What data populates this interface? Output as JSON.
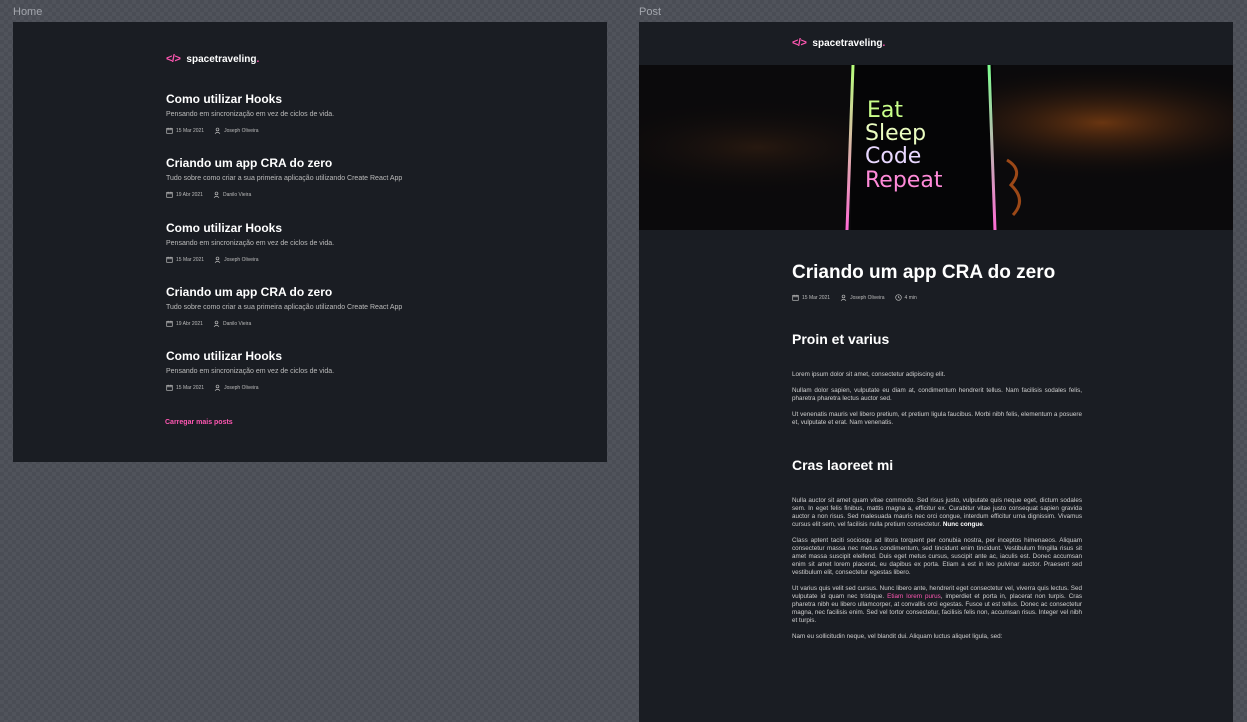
{
  "frames": {
    "home_label": "Home",
    "post_label": "Post"
  },
  "brand": {
    "code": "</>",
    "name": "spacetraveling",
    "dot": ".",
    "accent": "#ff57b2"
  },
  "home": {
    "posts": [
      {
        "title": "Como utilizar Hooks",
        "subtitle": "Pensando em sincronização em vez de ciclos de vida.",
        "date": "15 Mar 2021",
        "author": "Joseph Oliveira"
      },
      {
        "title": "Criando um app CRA do zero",
        "subtitle": "Tudo sobre como criar a sua primeira aplicação utilizando Create React App",
        "date": "19 Abr 2021",
        "author": "Danilo Vieira"
      },
      {
        "title": "Como utilizar Hooks",
        "subtitle": "Pensando em sincronização em vez de ciclos de vida.",
        "date": "15 Mar 2021",
        "author": "Joseph Oliveira"
      },
      {
        "title": "Criando um app CRA do zero",
        "subtitle": "Tudo sobre como criar a sua primeira aplicação utilizando Create React App",
        "date": "19 Abr 2021",
        "author": "Danilo Vieira"
      },
      {
        "title": "Como utilizar Hooks",
        "subtitle": "Pensando em sincronização em vez de ciclos de vida.",
        "date": "15 Mar 2021",
        "author": "Joseph Oliveira"
      }
    ],
    "load_more": "Carregar mais posts"
  },
  "post": {
    "banner_text": [
      "Eat",
      "Sleep",
      "Code",
      "Repeat"
    ],
    "title": "Criando um app CRA do zero",
    "date": "15 Mar 2021",
    "author": "Joseph Oliveira",
    "reading_time": "4 min",
    "section1": {
      "heading": "Proin et varius",
      "p1": "Lorem ipsum dolor sit amet, consectetur adipiscing elit.",
      "p2": "Nullam dolor sapien, vulputate eu diam at, condimentum hendrerit tellus. Nam facilisis sodales felis, pharetra pharetra lectus auctor sed.",
      "p3": "Ut venenatis mauris vel libero pretium, et pretium ligula faucibus. Morbi nibh felis, elementum a posuere et, vulputate et erat. Nam venenatis."
    },
    "section2": {
      "heading": "Cras laoreet mi",
      "p1_a": "Nulla auctor sit amet quam ",
      "p1_em": "vitae",
      "p1_b": " commodo. Sed risus justo, vulputate quis neque eget, dictum sodales sem. In eget felis finibus, mattis magna a, efficitur ex. Curabitur vitae justo consequat sapien gravida auctor a non risus. Sed malesuada mauris nec orci congue, interdum efficitur urna dignissim. Vivamus cursus elit sem, vel facilisis nulla pretium consectetur. ",
      "p1_bold": "Nunc congue",
      "p1_end": ".",
      "p2": "Class aptent taciti sociosqu ad litora torquent per conubia nostra, per inceptos himenaeos. Aliquam consectetur massa nec metus condimentum, sed tincidunt enim tincidunt. Vestibulum fringilla risus sit amet massa suscipit eleifend. Duis eget metus cursus, suscipit ante ac, iaculis est. Donec accumsan enim sit amet lorem placerat, eu dapibus ex porta. Etiam a est in leo pulvinar auctor. Praesent sed vestibulum elit, consectetur egestas libero.",
      "p3_a": "Ut varius quis velit sed cursus. Nunc libero ante, hendrerit eget consectetur vel, viverra quis lectus. Sed vulputate id quam nec tristique. ",
      "p3_link": "Etiam lorem purus",
      "p3_b": ", imperdiet et porta in, placerat non turpis. Cras pharetra nibh eu libero ullamcorper, at convallis orci egestas. Fusce ut est tellus. Donec ac consectetur magna, nec facilisis enim. Sed vel tortor consectetur, facilisis felis non, accumsan risus. Integer vel nibh et turpis.",
      "p4": "Nam eu sollicitudin neque, vel blandit dui. Aliquam luctus aliquet ligula, sed:"
    }
  }
}
